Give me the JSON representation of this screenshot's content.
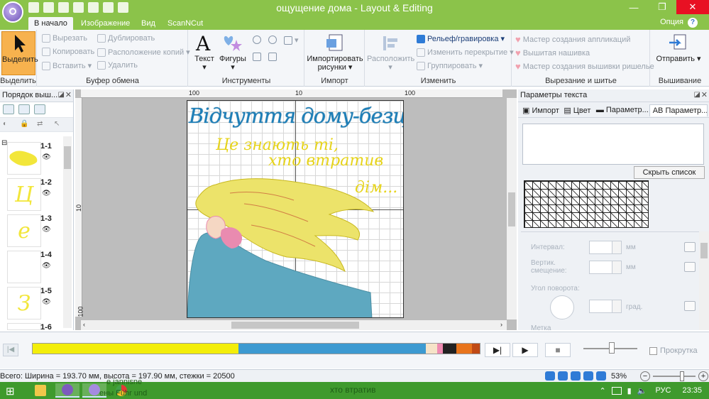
{
  "window": {
    "title": "ощущение дома - Layout & Editing",
    "controls": [
      "—",
      "❐",
      "✕"
    ]
  },
  "tabs": {
    "items": [
      "В начало",
      "Изображение",
      "Вид",
      "ScanNCut"
    ],
    "option_label": "Опция",
    "help": "?"
  },
  "ribbon": {
    "select": {
      "label": "Выделить",
      "group": "Выделить"
    },
    "clipboard": {
      "group": "Буфер обмена",
      "cut": "Вырезать",
      "copy": "Копировать",
      "paste": "Вставить",
      "duplicate": "Дублировать",
      "copy_layout": "Расположение копий",
      "delete": "Удалить"
    },
    "tools": {
      "group": "Инструменты",
      "text": "Текст",
      "shapes": "Фигуры"
    },
    "import": {
      "group": "Импорт",
      "label": "Импортировать рисунки"
    },
    "change": {
      "group": "Изменить",
      "arrange": "Расположить",
      "relief": "Рельеф/гравировка",
      "overlap": "Изменить перекрытие",
      "group_cmd": "Группировать"
    },
    "cutsew": {
      "group": "Вырезание и шитье",
      "applique": "Мастер создания аппликаций",
      "embroidered": "Вышитая нашивка",
      "richelieu": "Мастер создания вышивки ришелье"
    },
    "send": {
      "group": "Вышивание",
      "label": "Отправить"
    }
  },
  "left_panel": {
    "title": "Порядок выш...",
    "layers": [
      {
        "name": "1-1",
        "glyph": "~"
      },
      {
        "name": "1-2",
        "glyph": "Ц"
      },
      {
        "name": "1-3",
        "glyph": "е"
      },
      {
        "name": "1-4",
        "glyph": ""
      },
      {
        "name": "1-5",
        "glyph": "З"
      },
      {
        "name": "1-6",
        "glyph": ""
      }
    ]
  },
  "canvas": {
    "ruler_h": [
      "100",
      "10",
      "100"
    ],
    "ruler_v": [
      "10",
      "100"
    ],
    "design_lines": [
      "Відчуття дому-безцінне!",
      "Це знають ті,",
      "хто втратив",
      "дім..."
    ],
    "thread_colors": {
      "blue": "#1e7fb8",
      "yellow": "#f2e63a",
      "dress": "#5ea8c0",
      "pink": "#e98bb0",
      "red": "#c0392b"
    }
  },
  "right_panel": {
    "title": "Параметры текста",
    "tabs": [
      "Импорт",
      "Цвет",
      "Параметр...",
      "Параметр..."
    ],
    "hide_list": "Скрыть список",
    "params": {
      "interval": "Интервал:",
      "vertical_offset": "Вертик. смещение:",
      "rotation_angle": "Угол поворота:",
      "more": "Метка",
      "unit_mm": "мм",
      "unit_deg": "град."
    }
  },
  "player": {
    "start": "|◀",
    "end": "▶|",
    "play": "▶",
    "stop": "■",
    "scroll_label": "Прокрутка",
    "segments": [
      {
        "color": "#f3ee0a",
        "fraction": 0.46
      },
      {
        "color": "#3d9ad1",
        "fraction": 0.42
      },
      {
        "color": "#f6e3c8",
        "fraction": 0.025
      },
      {
        "color": "#ef8bb2",
        "fraction": 0.012
      },
      {
        "color": "#222222",
        "fraction": 0.03
      },
      {
        "color": "#e8741c",
        "fraction": 0.035
      },
      {
        "color": "#c04a15",
        "fraction": 0.018
      }
    ]
  },
  "status": {
    "text": "Всего: Ширина = 193.70 мм, высота = 197.90 мм, стежки = 20500",
    "zoom": "53%"
  },
  "taskbar": {
    "ghost_text": "хто втратив",
    "ghost2": "е jannisne",
    "ghost3": "ены Führ und",
    "lang": "РУС",
    "time": "23:35"
  }
}
